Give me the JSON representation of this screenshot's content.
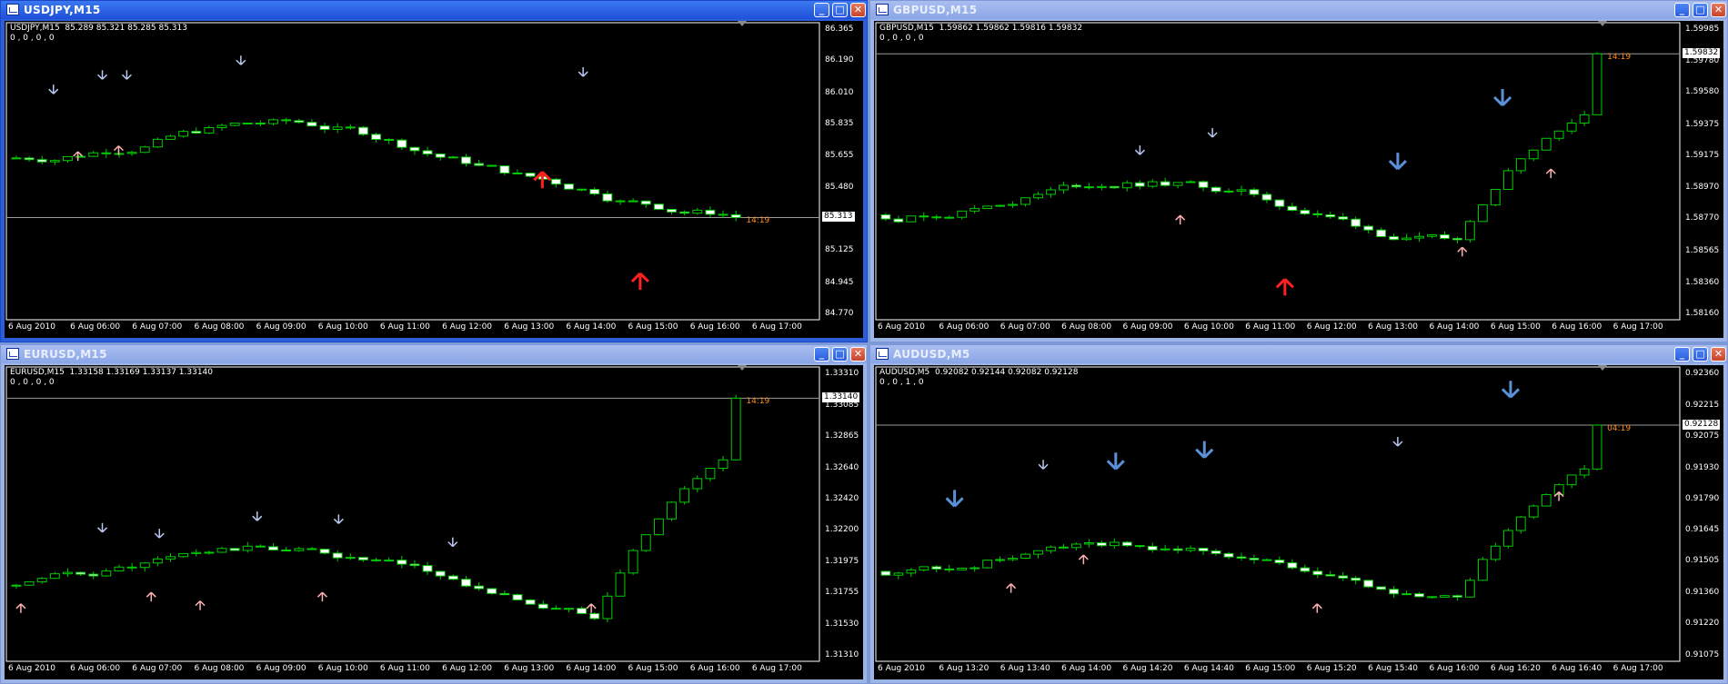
{
  "windows": [
    {
      "id": "usdjpy",
      "title": "USDJPY,M15",
      "active": true,
      "symbol_line": "USDJPY,M15  85.289 85.321 85.285 85.313",
      "indicator_line": "0 , 0 , 0 , 0",
      "bid": "85.313",
      "timer": "14:19",
      "y_ticks": [
        "86.365",
        "86.190",
        "86.010",
        "85.835",
        "85.655",
        "85.480",
        "85.313",
        "85.125",
        "84.945",
        "84.770"
      ],
      "x_ticks": [
        "6 Aug 2010",
        "6 Aug 06:00",
        "6 Aug 07:00",
        "6 Aug 08:00",
        "6 Aug 09:00",
        "6 Aug 10:00",
        "6 Aug 11:00",
        "6 Aug 12:00",
        "6 Aug 13:00",
        "6 Aug 14:00",
        "6 Aug 15:00",
        "6 Aug 16:00",
        "6 Aug 17:00"
      ]
    },
    {
      "id": "gbpusd",
      "title": "GBPUSD,M15",
      "active": false,
      "symbol_line": "GBPUSD,M15  1.59862 1.59862 1.59816 1.59832",
      "indicator_line": "0 , 0 , 0 , 0",
      "bid": "1.59832",
      "timer": "14:19",
      "y_ticks": [
        "1.59985",
        "1.59780",
        "1.59580",
        "1.59375",
        "1.59175",
        "1.58970",
        "1.58770",
        "1.58565",
        "1.58360",
        "1.58160"
      ],
      "x_ticks": [
        "6 Aug 2010",
        "6 Aug 06:00",
        "6 Aug 07:00",
        "6 Aug 08:00",
        "6 Aug 09:00",
        "6 Aug 10:00",
        "6 Aug 11:00",
        "6 Aug 12:00",
        "6 Aug 13:00",
        "6 Aug 14:00",
        "6 Aug 15:00",
        "6 Aug 16:00",
        "6 Aug 17:00"
      ]
    },
    {
      "id": "eurusd",
      "title": "EURUSD,M15",
      "active": false,
      "symbol_line": "EURUSD,M15  1.33158 1.33169 1.33137 1.33140",
      "indicator_line": "0 , 0 , 0 , 0",
      "bid": "1.33140",
      "timer": "14:19",
      "y_ticks": [
        "1.33310",
        "1.33085",
        "1.32865",
        "1.32640",
        "1.32420",
        "1.32200",
        "1.31975",
        "1.31755",
        "1.31530",
        "1.31310"
      ],
      "x_ticks": [
        "6 Aug 2010",
        "6 Aug 06:00",
        "6 Aug 07:00",
        "6 Aug 08:00",
        "6 Aug 09:00",
        "6 Aug 10:00",
        "6 Aug 11:00",
        "6 Aug 12:00",
        "6 Aug 13:00",
        "6 Aug 14:00",
        "6 Aug 15:00",
        "6 Aug 16:00",
        "6 Aug 17:00"
      ]
    },
    {
      "id": "audusd",
      "title": "AUDUSD,M5",
      "active": false,
      "symbol_line": "AUDUSD,M5  0.92082 0.92144 0.92082 0.92128",
      "indicator_line": "0 , 0 , 1 , 0",
      "bid": "0.92128",
      "timer": "04:19",
      "y_ticks": [
        "0.92360",
        "0.92215",
        "0.92075",
        "0.91930",
        "0.91790",
        "0.91645",
        "0.91505",
        "0.91360",
        "0.91220",
        "0.91075"
      ],
      "x_ticks": [
        "6 Aug 2010",
        "6 Aug 13:20",
        "6 Aug 13:40",
        "6 Aug 14:00",
        "6 Aug 14:20",
        "6 Aug 14:40",
        "6 Aug 15:00",
        "6 Aug 15:20",
        "6 Aug 15:40",
        "6 Aug 16:00",
        "6 Aug 16:20",
        "6 Aug 16:40",
        "6 Aug 17:00"
      ]
    }
  ],
  "colors": {
    "bull": "#000000",
    "bear": "#ffffff",
    "wick": "#00cc00",
    "bidline": "#9a9a9a",
    "timer": "#ff8c1a",
    "up_small": "#ffb0b0",
    "down_small": "#b8c8f0",
    "up_big": "#ff2020",
    "down_big": "#5a90d8"
  }
}
